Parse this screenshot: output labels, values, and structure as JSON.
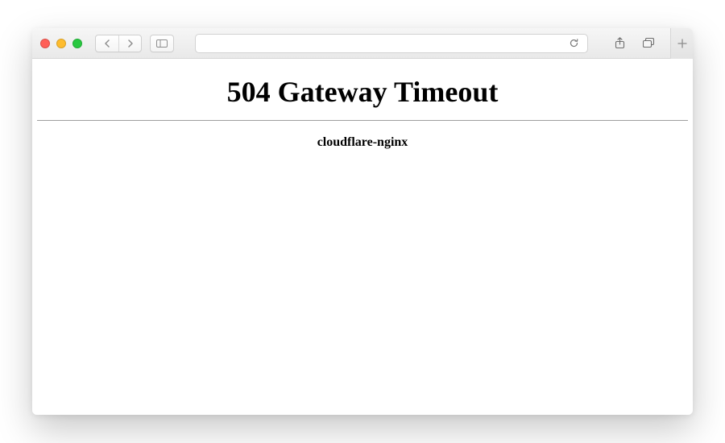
{
  "page": {
    "heading": "504 Gateway Timeout",
    "server": "cloudflare-nginx"
  }
}
